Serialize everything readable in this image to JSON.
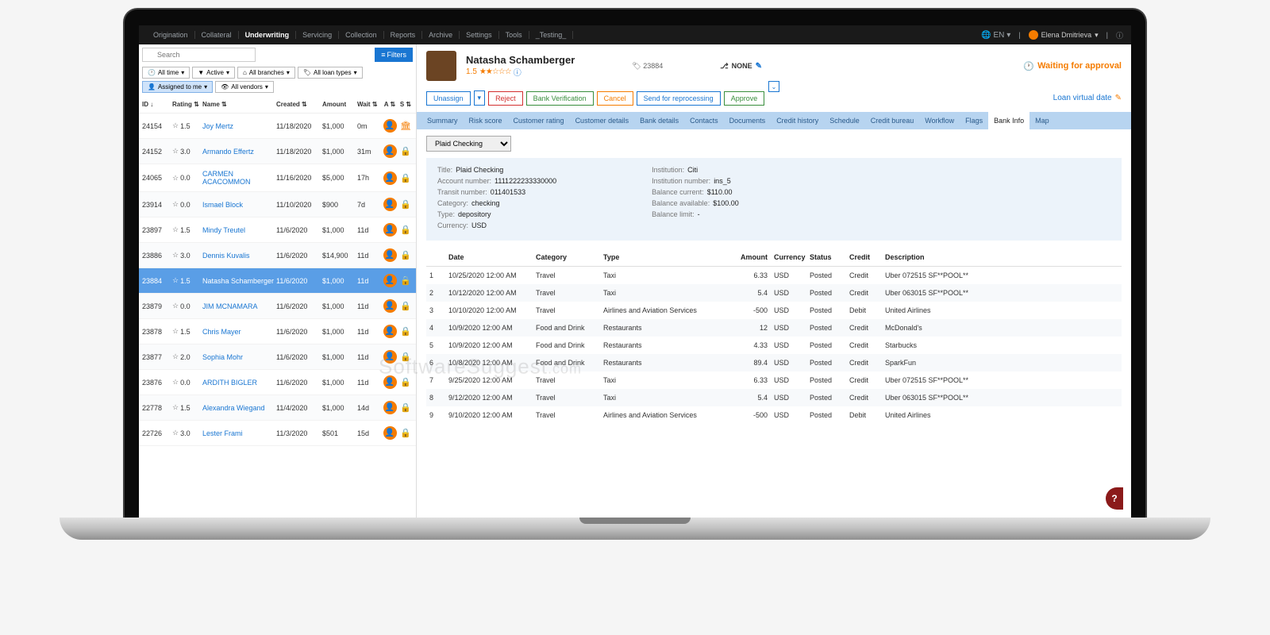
{
  "nav": {
    "items": [
      "Origination",
      "Collateral",
      "Underwriting",
      "Servicing",
      "Collection",
      "Reports",
      "Archive",
      "Settings",
      "Tools",
      "_Testing_"
    ],
    "active": "Underwriting",
    "language": "EN",
    "user": "Elena Dmitrieva"
  },
  "search": {
    "placeholder": "Search",
    "filters_btn": "Filters"
  },
  "filter_chips": {
    "time": "All time",
    "active": "Active",
    "branches": "All branches",
    "loan_types": "All loan types",
    "assigned": "Assigned to me",
    "vendors": "All vendors"
  },
  "list": {
    "columns": {
      "id": "ID",
      "rating": "Rating",
      "name": "Name",
      "created": "Created",
      "amount": "Amount",
      "wait": "Wait",
      "a": "A",
      "s": "S"
    },
    "rows": [
      {
        "id": "24154",
        "rating": "1.5",
        "name": "Joy Mertz",
        "created": "11/18/2020",
        "amount": "$1,000",
        "wait": "0m",
        "s": "bank"
      },
      {
        "id": "24152",
        "rating": "3.0",
        "name": "Armando Effertz",
        "created": "11/18/2020",
        "amount": "$1,000",
        "wait": "31m",
        "s": "lock"
      },
      {
        "id": "24065",
        "rating": "0.0",
        "name": "CARMEN ACACOMMON",
        "created": "11/16/2020",
        "amount": "$5,000",
        "wait": "17h",
        "s": "lock"
      },
      {
        "id": "23914",
        "rating": "0.0",
        "name": "Ismael Block",
        "created": "11/10/2020",
        "amount": "$900",
        "wait": "7d",
        "s": "lock"
      },
      {
        "id": "23897",
        "rating": "1.5",
        "name": "Mindy Treutel",
        "created": "11/6/2020",
        "amount": "$1,000",
        "wait": "11d",
        "s": "lock"
      },
      {
        "id": "23886",
        "rating": "3.0",
        "name": "Dennis Kuvalis",
        "created": "11/6/2020",
        "amount": "$14,900",
        "wait": "11d",
        "s": "lock"
      },
      {
        "id": "23884",
        "rating": "1.5",
        "name": "Natasha Schamberger",
        "created": "11/6/2020",
        "amount": "$1,000",
        "wait": "11d",
        "selected": true,
        "s": "lock"
      },
      {
        "id": "23879",
        "rating": "0.0",
        "name": "JIM MCNAMARA",
        "created": "11/6/2020",
        "amount": "$1,000",
        "wait": "11d",
        "s": "lock"
      },
      {
        "id": "23878",
        "rating": "1.5",
        "name": "Chris Mayer",
        "created": "11/6/2020",
        "amount": "$1,000",
        "wait": "11d",
        "s": "lock"
      },
      {
        "id": "23877",
        "rating": "2.0",
        "name": "Sophia Mohr",
        "created": "11/6/2020",
        "amount": "$1,000",
        "wait": "11d",
        "s": "lock"
      },
      {
        "id": "23876",
        "rating": "0.0",
        "name": "ARDITH BIGLER",
        "created": "11/6/2020",
        "amount": "$1,000",
        "wait": "11d",
        "s": "lock"
      },
      {
        "id": "22778",
        "rating": "1.5",
        "name": "Alexandra Wiegand",
        "created": "11/4/2020",
        "amount": "$1,000",
        "wait": "14d",
        "s": "lock"
      },
      {
        "id": "22726",
        "rating": "3.0",
        "name": "Lester Frami",
        "created": "11/3/2020",
        "amount": "$501",
        "wait": "15d",
        "s": "lock"
      }
    ]
  },
  "profile": {
    "name": "Natasha Schamberger",
    "rating": "1.5",
    "tag": "23884",
    "branch": "NONE",
    "status": "Waiting for approval"
  },
  "actions": {
    "unassign": "Unassign",
    "reject": "Reject",
    "verify": "Bank Verification",
    "cancel": "Cancel",
    "reprocess": "Send for reprocessing",
    "approve": "Approve",
    "loan_date": "Loan virtual date"
  },
  "tabs": [
    "Summary",
    "Risk score",
    "Customer rating",
    "Customer details",
    "Bank details",
    "Contacts",
    "Documents",
    "Credit history",
    "Schedule",
    "Credit bureau",
    "Workflow",
    "Flags",
    "Bank Info",
    "Map"
  ],
  "active_tab": "Bank Info",
  "bank_select": "Plaid Checking",
  "bank_info": {
    "left": [
      {
        "k": "Title:",
        "v": "Plaid Checking"
      },
      {
        "k": "Account number:",
        "v": "1111222233330000"
      },
      {
        "k": "Transit number:",
        "v": "011401533"
      },
      {
        "k": "Category:",
        "v": "checking"
      },
      {
        "k": "Type:",
        "v": "depository"
      },
      {
        "k": "Currency:",
        "v": "USD"
      }
    ],
    "right": [
      {
        "k": "Institution:",
        "v": "Citi"
      },
      {
        "k": "Institution number:",
        "v": "ins_5"
      },
      {
        "k": "Balance current:",
        "v": "$110.00"
      },
      {
        "k": "Balance available:",
        "v": "$100.00"
      },
      {
        "k": "Balance limit:",
        "v": "-"
      }
    ]
  },
  "tx": {
    "columns": {
      "date": "Date",
      "category": "Category",
      "type": "Type",
      "amount": "Amount",
      "currency": "Currency",
      "status": "Status",
      "credit": "Credit",
      "description": "Description"
    },
    "rows": [
      {
        "idx": "1",
        "date": "10/25/2020 12:00 AM",
        "cat": "Travel",
        "type": "Taxi",
        "amt": "6.33",
        "cur": "USD",
        "stat": "Posted",
        "cd": "Credit",
        "desc": "Uber 072515 SF**POOL**"
      },
      {
        "idx": "2",
        "date": "10/12/2020 12:00 AM",
        "cat": "Travel",
        "type": "Taxi",
        "amt": "5.4",
        "cur": "USD",
        "stat": "Posted",
        "cd": "Credit",
        "desc": "Uber 063015 SF**POOL**"
      },
      {
        "idx": "3",
        "date": "10/10/2020 12:00 AM",
        "cat": "Travel",
        "type": "Airlines and Aviation Services",
        "amt": "-500",
        "cur": "USD",
        "stat": "Posted",
        "cd": "Debit",
        "desc": "United Airlines"
      },
      {
        "idx": "4",
        "date": "10/9/2020 12:00 AM",
        "cat": "Food and Drink",
        "type": "Restaurants",
        "amt": "12",
        "cur": "USD",
        "stat": "Posted",
        "cd": "Credit",
        "desc": "McDonald's"
      },
      {
        "idx": "5",
        "date": "10/9/2020 12:00 AM",
        "cat": "Food and Drink",
        "type": "Restaurants",
        "amt": "4.33",
        "cur": "USD",
        "stat": "Posted",
        "cd": "Credit",
        "desc": "Starbucks"
      },
      {
        "idx": "6",
        "date": "10/8/2020 12:00 AM",
        "cat": "Food and Drink",
        "type": "Restaurants",
        "amt": "89.4",
        "cur": "USD",
        "stat": "Posted",
        "cd": "Credit",
        "desc": "SparkFun"
      },
      {
        "idx": "7",
        "date": "9/25/2020 12:00 AM",
        "cat": "Travel",
        "type": "Taxi",
        "amt": "6.33",
        "cur": "USD",
        "stat": "Posted",
        "cd": "Credit",
        "desc": "Uber 072515 SF**POOL**"
      },
      {
        "idx": "8",
        "date": "9/12/2020 12:00 AM",
        "cat": "Travel",
        "type": "Taxi",
        "amt": "5.4",
        "cur": "USD",
        "stat": "Posted",
        "cd": "Credit",
        "desc": "Uber 063015 SF**POOL**"
      },
      {
        "idx": "9",
        "date": "9/10/2020 12:00 AM",
        "cat": "Travel",
        "type": "Airlines and Aviation Services",
        "amt": "-500",
        "cur": "USD",
        "stat": "Posted",
        "cd": "Debit",
        "desc": "United Airlines"
      }
    ]
  },
  "watermark_a": "SoftwareSuggest",
  "watermark_b": ".com"
}
